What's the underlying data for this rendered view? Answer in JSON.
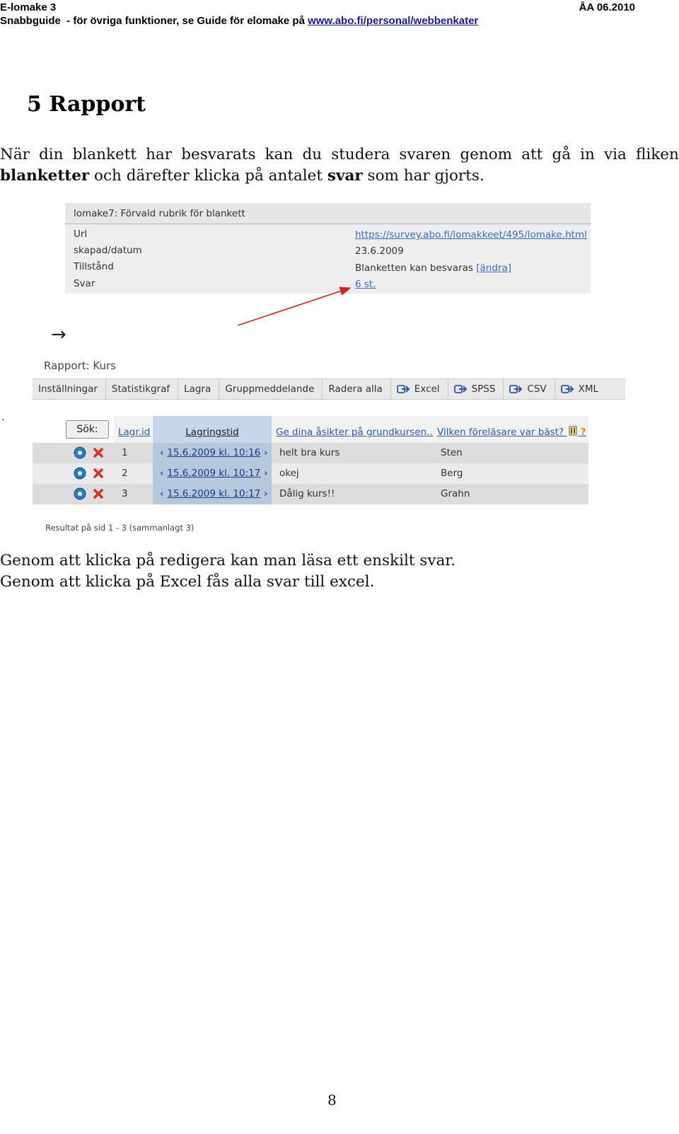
{
  "header": {
    "app": "E-lomake 3",
    "date": "ÅA 06.2010",
    "subtitle_prefix": "Snabbguide  - för övriga funktioner, se Guide för elomake på ",
    "subtitle_link": "www.abo.fi/personal/webbenkater"
  },
  "section_title": "5 Rapport",
  "intro": {
    "line1_words": [
      "När",
      "din",
      "blankett",
      "har",
      "besvarats",
      "kan",
      "du",
      "studera",
      "svaren",
      "genom",
      "att",
      "gå",
      "in",
      "via",
      "fliken"
    ],
    "line2_bold1": "blanketter",
    "line2_text1": " och därefter klicka på antalet ",
    "line2_bold2": "svar",
    "line2_text2": " som har gjorts."
  },
  "form_info": {
    "title": "lomake7: Förvald rubrik för blankett",
    "rows": [
      {
        "label": "Url",
        "value": "https://survey.abo.fi/lomakkeet/495/lomake.html"
      },
      {
        "label": "skapad/datum",
        "value": "23.6.2009"
      },
      {
        "label": "Tillstånd",
        "value": "Blanketten kan besvaras ",
        "link": "[ändra]"
      },
      {
        "label": "Svar",
        "value": "6 st."
      }
    ]
  },
  "right_arrow": "→",
  "report": {
    "title": "Rapport: Kurs",
    "toolbar": [
      "Inställningar",
      "Statistikgraf",
      "Lagra",
      "Gruppmeddelande",
      "Radera alla",
      "Excel",
      "SPSS",
      "CSV",
      "XML"
    ],
    "search_button": "Sök:",
    "columns": [
      "Lagr.id",
      "Lagringstid",
      "Ge dina åsikter på grundkursen...",
      "Vilken föreläsare var bäst?"
    ],
    "help_icon": "?",
    "rows": [
      {
        "id": "1",
        "time": "15.6.2009 kl. 10:16",
        "opinion": "helt bra kurs",
        "lecturer": "Sten"
      },
      {
        "id": "2",
        "time": "15.6.2009 kl. 10:17",
        "opinion": "okej",
        "lecturer": "Berg"
      },
      {
        "id": "3",
        "time": "15.6.2009 kl. 10:17",
        "opinion": "Dålig kurs!!",
        "lecturer": "Grahn"
      }
    ],
    "status": "Resultat på sid 1 - 3 (sammanlagt 3)"
  },
  "dot_mark": ".",
  "body_lines": [
    "Genom att klicka på redigera kan man läsa ett enskilt svar.",
    "Genom att klicka på Excel fås alla svar till excel."
  ],
  "page_number": "8",
  "colors": {
    "link": "#3a6cc0",
    "annotation_arrow": "#d42020",
    "sorted_column": "#c7d6ea"
  }
}
